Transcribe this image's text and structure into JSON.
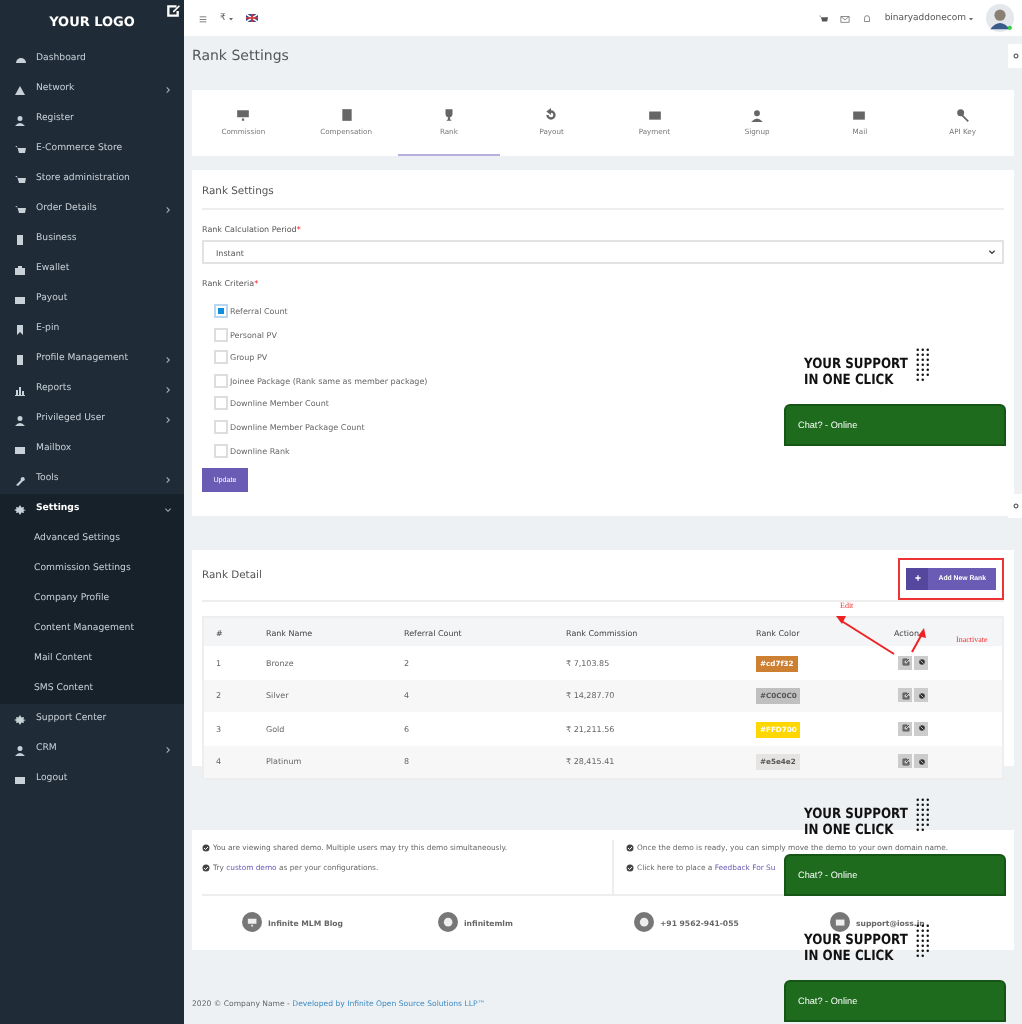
{
  "sidebar": {
    "logo": "YOUR LOGO",
    "items": [
      {
        "label": "Dashboard",
        "arrow": false,
        "selected": false
      },
      {
        "label": "Network",
        "arrow": true,
        "selected": false
      },
      {
        "label": "Register",
        "arrow": false,
        "selected": false
      },
      {
        "label": "E-Commerce Store",
        "arrow": false,
        "selected": false
      },
      {
        "label": "Store administration",
        "arrow": false,
        "selected": false
      },
      {
        "label": "Order Details",
        "arrow": true,
        "selected": false
      },
      {
        "label": "Business",
        "arrow": false,
        "selected": false
      },
      {
        "label": "Ewallet",
        "arrow": false,
        "selected": false
      },
      {
        "label": "Payout",
        "arrow": false,
        "selected": false
      },
      {
        "label": "E-pin",
        "arrow": false,
        "selected": false
      },
      {
        "label": "Profile Management",
        "arrow": true,
        "selected": false
      },
      {
        "label": "Reports",
        "arrow": true,
        "selected": false
      },
      {
        "label": "Privileged User",
        "arrow": true,
        "selected": false
      },
      {
        "label": "Mailbox",
        "arrow": false,
        "selected": false
      },
      {
        "label": "Tools",
        "arrow": true,
        "selected": false
      },
      {
        "label": "Settings",
        "arrow": true,
        "selected": true,
        "expanded": true,
        "children": [
          {
            "label": "Advanced Settings"
          },
          {
            "label": "Commission Settings"
          },
          {
            "label": "Company Profile"
          },
          {
            "label": "Content Management"
          },
          {
            "label": "Mail Content"
          },
          {
            "label": "SMS Content"
          }
        ]
      },
      {
        "label": "Support Center",
        "arrow": false,
        "selected": false
      },
      {
        "label": "CRM",
        "arrow": true,
        "selected": false
      },
      {
        "label": "Logout",
        "arrow": false,
        "selected": false
      }
    ]
  },
  "topbar": {
    "currency": "₹",
    "user": "binaryaddonecom"
  },
  "page_title": "Rank Settings",
  "tabs": [
    {
      "label": "Commission",
      "selected": false
    },
    {
      "label": "Compensation",
      "selected": false
    },
    {
      "label": "Rank",
      "selected": true
    },
    {
      "label": "Payout",
      "selected": false
    },
    {
      "label": "Payment",
      "selected": false
    },
    {
      "label": "Signup",
      "selected": false
    },
    {
      "label": "Mail",
      "selected": false
    },
    {
      "label": "API Key",
      "selected": false
    }
  ],
  "rank_settings": {
    "title": "Rank Settings",
    "period_label": "Rank Calculation Period",
    "period_value": "Instant",
    "criteria_label": "Rank Criteria",
    "required_mark": "*",
    "criteria": [
      {
        "label": "Referral Count",
        "checked": true
      },
      {
        "label": "Personal PV",
        "checked": false
      },
      {
        "label": "Group PV",
        "checked": false
      },
      {
        "label": "Joinee Package (Rank same as member package)",
        "checked": false
      },
      {
        "label": "Downline Member Count",
        "checked": false
      },
      {
        "label": "Downline Member Package Count",
        "checked": false
      },
      {
        "label": "Downline Rank",
        "checked": false
      }
    ],
    "button": "Update"
  },
  "rank_detail": {
    "title": "Rank Detail",
    "add_button": "Add New Rank",
    "edit_note": "Edit",
    "inactivate_note": "Inactivate",
    "columns": [
      "#",
      "Rank Name",
      "Referral Count",
      "Rank Commission",
      "Rank Color",
      "Action"
    ],
    "rows": [
      {
        "no": "1",
        "name": "Bronze",
        "referral": "2",
        "commission": "₹ 7,103.85",
        "color": "#cd7f32",
        "color_text": "#cd7f32"
      },
      {
        "no": "2",
        "name": "Silver",
        "referral": "4",
        "commission": "₹ 14,287.70",
        "color": "#c0c0c0",
        "color_text": "#C0C0C0"
      },
      {
        "no": "3",
        "name": "Gold",
        "referral": "6",
        "commission": "₹ 21,211.56",
        "color": "#ffd700",
        "color_text": "#FFD700"
      },
      {
        "no": "4",
        "name": "Platinum",
        "referral": "8",
        "commission": "₹ 28,415.41",
        "color": "#e5e4e2",
        "color_text": "#e5e4e2"
      }
    ]
  },
  "notes": [
    {
      "before": "You are viewing shared demo. Multiple users may try this demo simultaneously."
    },
    {
      "before": "Try ",
      "link": "custom demo",
      "after": " as per your configurations."
    },
    {
      "before": "Once the demo is ready, you can simply move the demo to your own domain name."
    },
    {
      "before": "Click here to place a ",
      "link": "Feedback For Su"
    }
  ],
  "contacts": [
    {
      "label": "Infinite MLM Blog"
    },
    {
      "label": "infinitemlm"
    },
    {
      "label": "+91 9562-941-055"
    },
    {
      "label": "support@ioss.in"
    }
  ],
  "copyright": {
    "text": "2020 © Company Name - ",
    "link": "Developed by Infinite Open Source Solutions LLP™"
  },
  "chat_widgets": [
    {
      "line1": "YOUR SUPPORT",
      "line2": "IN ONE CLICK",
      "chat": "Chat? - Online"
    },
    {
      "line1": "YOUR SUPPORT",
      "line2": "IN ONE CLICK",
      "chat": "Chat? - Online"
    },
    {
      "line1": "YOUR SUPPORT",
      "line2": "IN ONE CLICK",
      "chat": "Chat? - Online"
    }
  ]
}
